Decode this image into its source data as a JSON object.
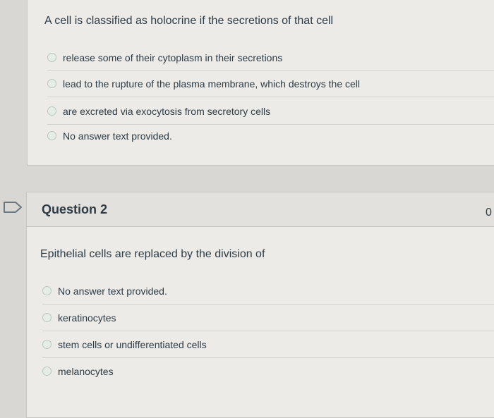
{
  "question1": {
    "prompt": "A cell is classified as holocrine if the secretions of that cell",
    "answers": [
      "release some of their cytoplasm in their secretions",
      "lead to the rupture of the plasma membrane, which destroys the cell",
      "are excreted via exocytosis from secretory cells",
      "No answer text provided."
    ]
  },
  "question2": {
    "title": "Question 2",
    "points": "0",
    "prompt": "Epithelial cells are replaced by the division of",
    "answers": [
      "No answer text provided.",
      "keratinocytes",
      "stem cells or undifferentiated cells",
      "melanocytes"
    ]
  },
  "icons": {
    "flag": "flag-icon",
    "radio": "radio-icon"
  },
  "colors": {
    "text": "#2d3b45",
    "panel": "#ecebe8",
    "header": "#e2e1de"
  }
}
